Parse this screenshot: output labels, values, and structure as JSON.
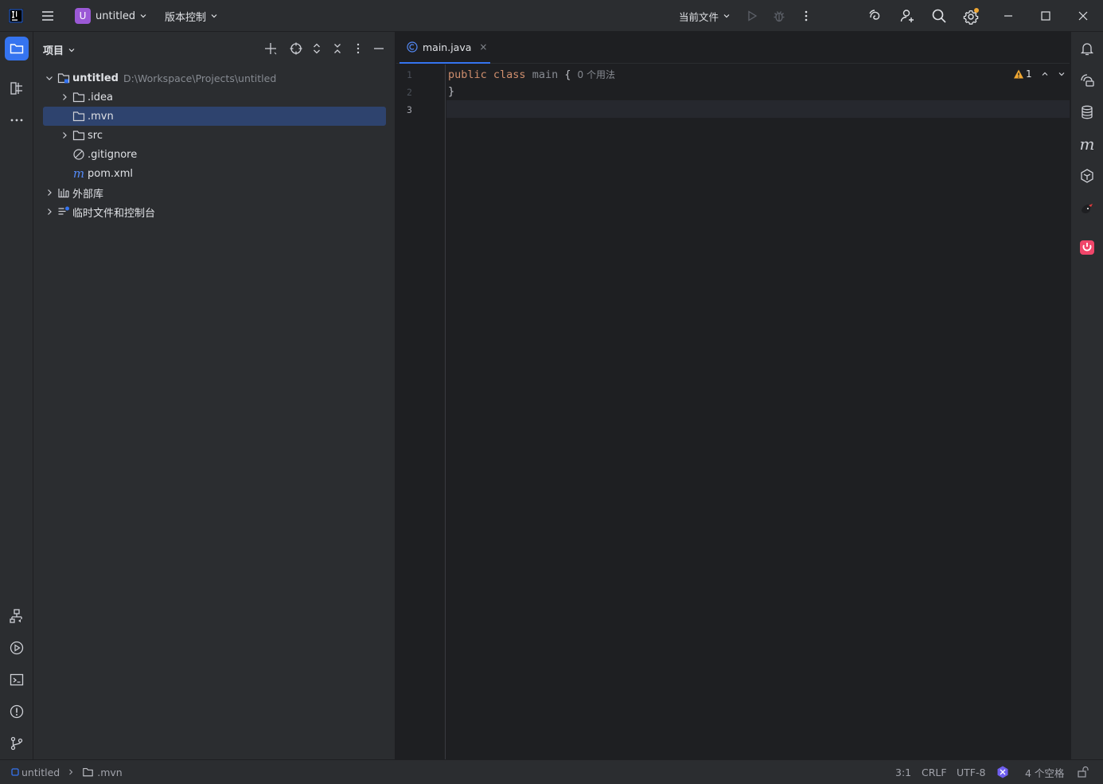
{
  "titlebar": {
    "app_icon": "intellij-idea-icon",
    "menu_icon": "hamburger-menu-icon",
    "project_badge": "U",
    "project_name": "untitled",
    "vcs_label": "版本控制",
    "run_config": "当前文件",
    "run_icon": "run-icon",
    "debug_icon": "debug-icon",
    "more_icon": "more-vertical-icon",
    "icons_right": [
      "ai-assistant-icon",
      "add-user-icon",
      "search-icon",
      "settings-icon"
    ],
    "window_controls": [
      "minimize-icon",
      "maximize-icon",
      "close-icon"
    ],
    "settings_dot_color": "#f0a732"
  },
  "left_strip": {
    "top": [
      "project-folder-icon",
      "structure-icon",
      "more-horizontal-icon"
    ],
    "bottom": [
      "services-icon",
      "run-icon",
      "terminal-icon",
      "problems-icon",
      "git-icon"
    ]
  },
  "right_strip": [
    "notifications-icon",
    "ai-chat-icon",
    "database-icon",
    "maven-icon",
    "ai-agent-icon",
    "code-with-me-icon",
    "plugin-icon"
  ],
  "project_panel": {
    "title": "项目",
    "header_icons": [
      "add-icon",
      "locate-icon",
      "expand-collapse-icon",
      "collapse-all-icon",
      "options-icon",
      "hide-icon"
    ],
    "tree": [
      {
        "label": "untitled",
        "path": "D:\\Workspace\\Projects\\untitled",
        "expanded": true,
        "icon": "module-folder-icon"
      },
      {
        "label": ".idea",
        "collapsed": true,
        "icon": "folder-icon"
      },
      {
        "label": ".mvn",
        "selected": true,
        "icon": "folder-icon"
      },
      {
        "label": "src",
        "collapsed": true,
        "icon": "folder-icon"
      },
      {
        "label": ".gitignore",
        "icon": "ignore-file-icon"
      },
      {
        "label": "pom.xml",
        "icon": "maven-file-icon"
      },
      {
        "label": "外部库",
        "collapsed": true,
        "icon": "library-icon"
      },
      {
        "label": "临时文件和控制台",
        "collapsed": true,
        "icon": "scratches-icon"
      }
    ]
  },
  "editor": {
    "tab": {
      "label": "main.java",
      "icon": "java-class-icon",
      "close": "×"
    },
    "line_numbers": [
      "1",
      "2",
      "3"
    ],
    "code": {
      "line1_kw1": "public",
      "line1_kw2": "class",
      "line1_name": "main",
      "line1_brace": "{",
      "line1_hint": "0 个用法",
      "line2": "}"
    },
    "inspection_count": "1"
  },
  "statusbar": {
    "breadcrumb_project": "untitled",
    "breadcrumb_folder": ".mvn",
    "position": "3:1",
    "line_sep": "CRLF",
    "encoding": "UTF-8",
    "indent": "4 个空格"
  }
}
